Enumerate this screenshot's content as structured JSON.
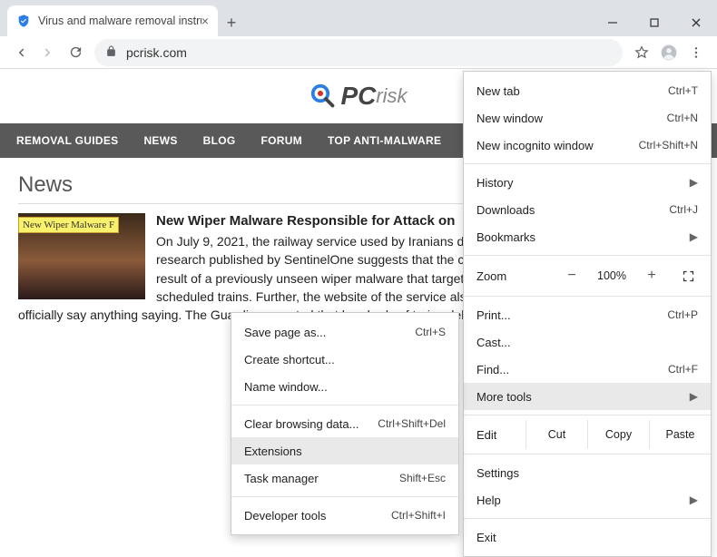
{
  "window": {
    "tab_title": "Virus and malware removal instru",
    "url": "pcrisk.com"
  },
  "site": {
    "logo_main": "PC",
    "logo_sub": "risk",
    "nav": [
      "REMOVAL GUIDES",
      "NEWS",
      "BLOG",
      "FORUM",
      "TOP ANTI-MALWARE"
    ],
    "section_heading": "News",
    "thumbnail_label": "New Wiper Malware F",
    "article_title": "New Wiper Malware Responsible for Attack on",
    "article_body": "On July 9, 2021, the railway service used by Iranians daily suffered a cyber attack. New research published by SentinelOne suggests that the chaos caused during the attack was a result of a previously unseen wiper malware that targeted the railway's services and delays of scheduled trains. Further, the website of the service also failed. The government has yet to officially say anything saying. The Guardian reported that hundreds of trains delayed or disruption in … computer syst"
  },
  "menu": {
    "new_tab": "New tab",
    "new_tab_sc": "Ctrl+T",
    "new_window": "New window",
    "new_window_sc": "Ctrl+N",
    "incognito": "New incognito window",
    "incognito_sc": "Ctrl+Shift+N",
    "history": "History",
    "downloads": "Downloads",
    "downloads_sc": "Ctrl+J",
    "bookmarks": "Bookmarks",
    "zoom_label": "Zoom",
    "zoom_value": "100%",
    "print": "Print...",
    "print_sc": "Ctrl+P",
    "cast": "Cast...",
    "find": "Find...",
    "find_sc": "Ctrl+F",
    "more_tools": "More tools",
    "edit_label": "Edit",
    "cut": "Cut",
    "copy": "Copy",
    "paste": "Paste",
    "settings": "Settings",
    "help": "Help",
    "exit": "Exit"
  },
  "submenu": {
    "save_page": "Save page as...",
    "save_page_sc": "Ctrl+S",
    "create_shortcut": "Create shortcut...",
    "name_window": "Name window...",
    "clear_browsing": "Clear browsing data...",
    "clear_browsing_sc": "Ctrl+Shift+Del",
    "extensions": "Extensions",
    "task_manager": "Task manager",
    "task_manager_sc": "Shift+Esc",
    "dev_tools": "Developer tools",
    "dev_tools_sc": "Ctrl+Shift+I"
  }
}
